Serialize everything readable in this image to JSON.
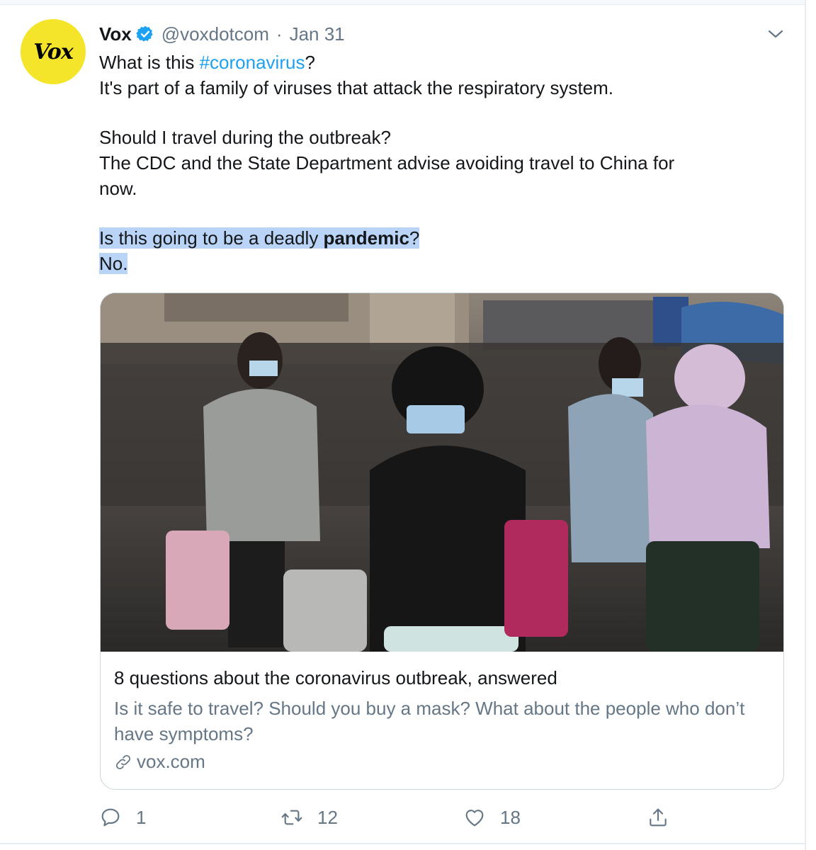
{
  "tweet": {
    "author_name": "Vox",
    "avatar_text": "Vox",
    "handle": "@voxdotcom",
    "separator": "·",
    "date": "Jan 31",
    "text": {
      "l1_before": "What is this ",
      "hashtag": "#coronavirus",
      "l1_after": "?",
      "l2": "It's part of a family of viruses that attack the respiratory system.",
      "l3": "Should I travel during the outbreak?",
      "l4": "The CDC and the State Department advise avoiding travel to China for",
      "l5": "now.",
      "l6_before": "Is this going to be a deadly ",
      "l6_bold": "pandemic",
      "l6_after": "? ",
      "l7": "No."
    }
  },
  "card": {
    "title": "8 questions about the coronavirus outbreak, answered",
    "description": "Is it safe to travel? Should you buy a mask? What about the people who don’t have symptoms?",
    "domain": "vox.com"
  },
  "actions": {
    "reply_count": "1",
    "retweet_count": "12",
    "like_count": "18"
  },
  "icons": {
    "verified": "verified-badge-icon",
    "caret": "chevron-down-icon",
    "link": "link-icon",
    "reply": "reply-icon",
    "retweet": "retweet-icon",
    "like": "heart-icon",
    "share": "share-icon"
  },
  "colors": {
    "link_blue": "#1da1f2",
    "muted_text": "#657786",
    "selection": "#b9d4f7",
    "avatar_yellow": "#f5e52a"
  }
}
